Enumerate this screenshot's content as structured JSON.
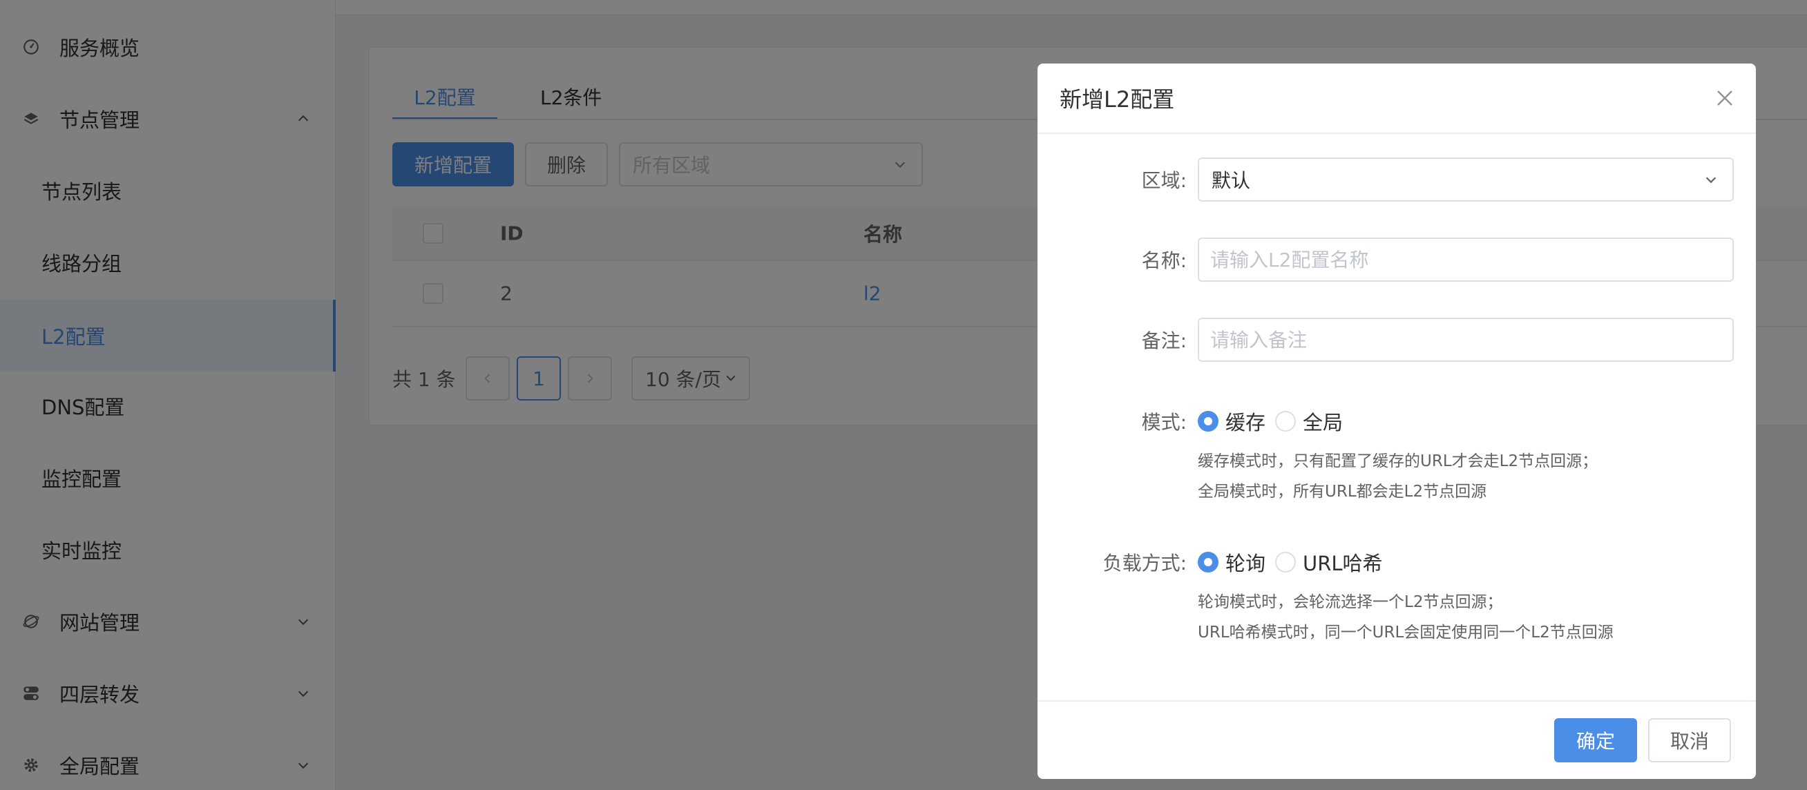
{
  "sidebar": {
    "items": [
      {
        "label": "服务概览",
        "icon": "dashboard-icon"
      },
      {
        "label": "节点管理",
        "icon": "layers-icon",
        "expanded": true
      },
      {
        "label": "节点列表"
      },
      {
        "label": "线路分组"
      },
      {
        "label": "L2配置",
        "active": true
      },
      {
        "label": "DNS配置"
      },
      {
        "label": "监控配置"
      },
      {
        "label": "实时监控"
      },
      {
        "label": "网站管理",
        "icon": "globe-icon",
        "expanded": false
      },
      {
        "label": "四层转发",
        "icon": "toggle-icon",
        "expanded": false
      },
      {
        "label": "全局配置",
        "icon": "gear-icon",
        "expanded": false
      }
    ]
  },
  "main": {
    "tabs": [
      {
        "label": "L2配置",
        "active": true
      },
      {
        "label": "L2条件"
      }
    ],
    "toolbar": {
      "add_label": "新增配置",
      "delete_label": "删除",
      "region_placeholder": "所有区域"
    },
    "table": {
      "columns": [
        "ID",
        "名称"
      ],
      "rows": [
        {
          "id": "2",
          "name": "l2"
        }
      ]
    },
    "pagination": {
      "total_text": "共 1 条",
      "current_page": "1",
      "page_size": "10 条/页"
    }
  },
  "dialog": {
    "title": "新增L2配置",
    "region": {
      "label": "区域:",
      "value": "默认"
    },
    "name": {
      "label": "名称:",
      "placeholder": "请输入L2配置名称"
    },
    "remark": {
      "label": "备注:",
      "placeholder": "请输入备注"
    },
    "mode": {
      "label": "模式:",
      "options": [
        "缓存",
        "全局"
      ],
      "selected": "缓存",
      "hints": [
        "缓存模式时，只有配置了缓存的URL才会走L2节点回源；",
        "全局模式时，所有URL都会走L2节点回源"
      ]
    },
    "balance": {
      "label": "负载方式:",
      "options": [
        "轮询",
        "URL哈希"
      ],
      "selected": "轮询",
      "hints": [
        "轮询模式时，会轮流选择一个L2节点回源；",
        "URL哈希模式时，同一个URL会固定使用同一个L2节点回源"
      ]
    },
    "confirm_label": "确定",
    "cancel_label": "取消"
  },
  "colors": {
    "accent": "#4a8ee8",
    "overlay": "rgba(0,0,0,0.5)"
  }
}
